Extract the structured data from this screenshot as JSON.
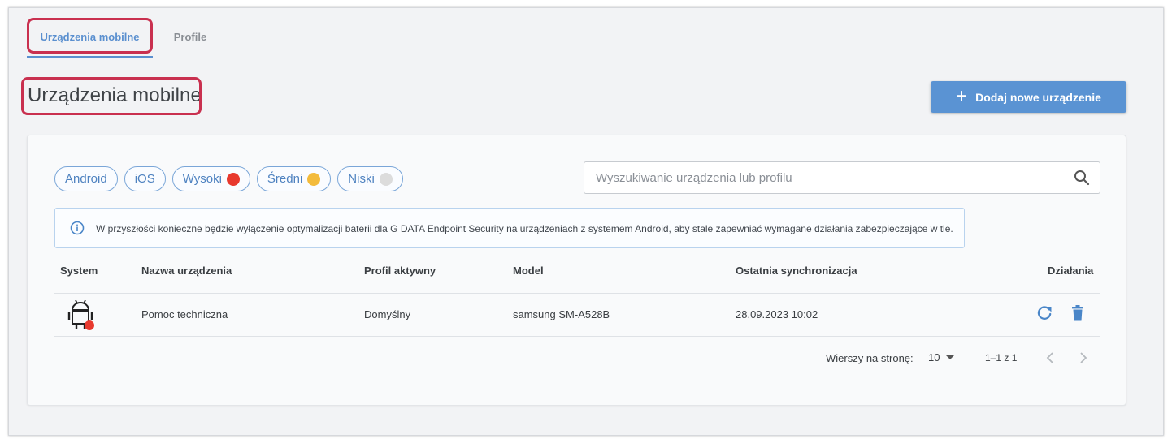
{
  "tabs": {
    "mobile": "Urządzenia mobilne",
    "profiles": "Profile"
  },
  "page": {
    "title": "Urządzenia mobilne",
    "add_button": "Dodaj nowe urządzenie"
  },
  "filters": {
    "chips": [
      {
        "label": "Android"
      },
      {
        "label": "iOS"
      },
      {
        "label": "Wysoki",
        "color": "#e8392e"
      },
      {
        "label": "Średni",
        "color": "#f3bb3c"
      },
      {
        "label": "Niski",
        "color": "#dcdcdc"
      }
    ]
  },
  "search": {
    "placeholder": "Wyszukiwanie urządzenia lub profilu"
  },
  "info": {
    "text": "W przyszłości konieczne będzie wyłączenie optymalizacji baterii dla G DATA Endpoint Security na urządzeniach z systemem Android, aby stale zapewniać wymagane działania zabezpieczające w tle."
  },
  "table": {
    "columns": {
      "system": "System",
      "name": "Nazwa urządzenia",
      "profile": "Profil aktywny",
      "model": "Model",
      "sync": "Ostatnia synchronizacja",
      "actions": "Działania"
    },
    "rows": [
      {
        "system_icon": "android-icon",
        "status_color": "#e8392e",
        "name": "Pomoc techniczna",
        "profile": "Domyślny",
        "model": "samsung SM-A528B",
        "sync": "28.09.2023 10:02"
      }
    ]
  },
  "pagination": {
    "rows_label": "Wierszy na stronę:",
    "rows_value": "10",
    "range": "1–1 z 1"
  },
  "colors": {
    "accent": "#5a93d3",
    "highlight": "#c9304f"
  }
}
